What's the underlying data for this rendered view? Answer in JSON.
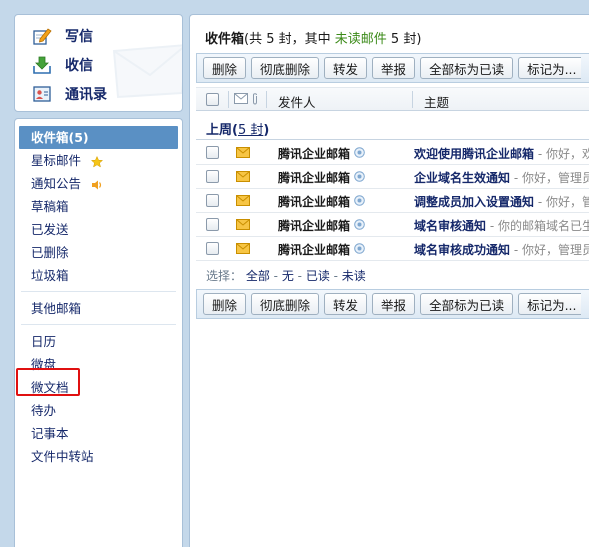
{
  "compose": {
    "write_label": "写信",
    "receive_label": "收信",
    "contacts_label": "通讯录"
  },
  "folders": {
    "inbox_label": "收件箱(5)",
    "starred_label": "星标邮件",
    "notices_label": "通知公告",
    "drafts_label": "草稿箱",
    "sent_label": "已发送",
    "deleted_label": "已删除",
    "spam_label": "垃圾箱",
    "other_label": "其他邮箱",
    "calendar_label": "日历",
    "weipan_label": "微盘",
    "weidoc_label": "微文档",
    "todo_label": "待办",
    "notes_label": "记事本",
    "transfer_label": "文件中转站"
  },
  "header": {
    "title": "收件箱",
    "summary_prefix": "(共 5 封，其中 ",
    "unread_label": "未读邮件",
    "summary_suffix": " 5 封)"
  },
  "toolbar": {
    "delete": "删除",
    "delete_permanent": "彻底删除",
    "forward": "转发",
    "report": "举报",
    "mark_all_read": "全部标为已读",
    "mark_as": "标记为..."
  },
  "columns": {
    "sender": "发件人",
    "subject": "主题"
  },
  "group": {
    "label": "上周",
    "count": "5 封"
  },
  "emails": [
    {
      "sender": "腾讯企业邮箱",
      "subject": "欢迎使用腾讯企业邮箱",
      "preview": " - 你好，欢迎"
    },
    {
      "sender": "腾讯企业邮箱",
      "subject": "企业域名生效通知",
      "preview": " - 你好，管理员"
    },
    {
      "sender": "腾讯企业邮箱",
      "subject": "调整成员加入设置通知",
      "preview": " - 你好，管理"
    },
    {
      "sender": "腾讯企业邮箱",
      "subject": "域名审核通知",
      "preview": " - 你的邮箱域名已生效"
    },
    {
      "sender": "腾讯企业邮箱",
      "subject": "域名审核成功通知",
      "preview": " - 你好，管理员"
    }
  ],
  "selection": {
    "prefix": "选择：",
    "all": "全部",
    "none": "无",
    "read": "已读",
    "unread": "未读",
    "sep": " - "
  },
  "colors": {
    "accent": "#5a90c4",
    "link": "#15286a",
    "unread_green": "#3b8a18",
    "highlight_red": "#e01010"
  }
}
